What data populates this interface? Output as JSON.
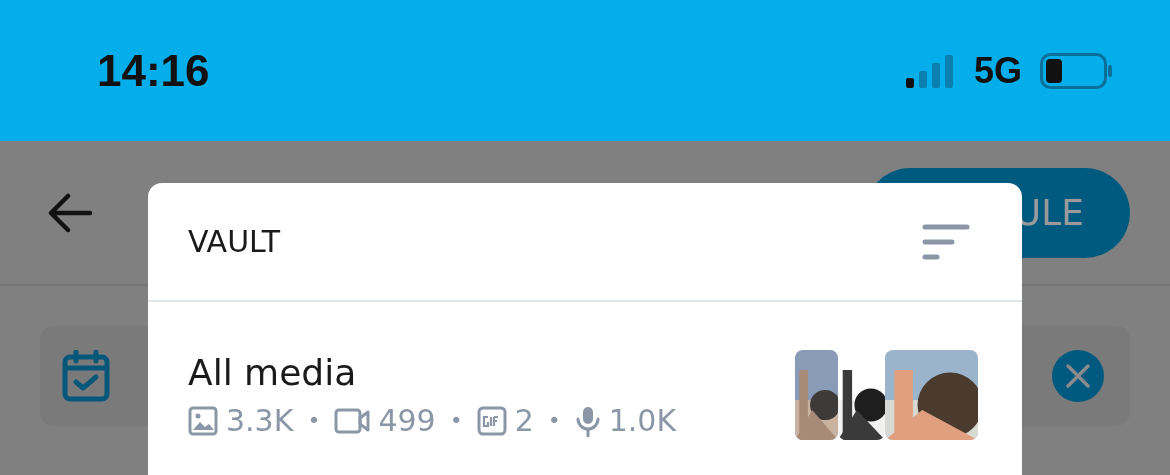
{
  "status_bar": {
    "time": "14:16",
    "network": "5G"
  },
  "background_page": {
    "action_button": "ULE"
  },
  "vault": {
    "title": "VAULT",
    "items": [
      {
        "name": "All media",
        "separator": "•",
        "counts": [
          {
            "value": "3.3K"
          },
          {
            "kind": "video",
            "value": "499"
          },
          {
            "kind": "gif",
            "value": "2"
          },
          {
            "kind": "audio",
            "value": "1.0K"
          }
        ]
      }
    ]
  }
}
